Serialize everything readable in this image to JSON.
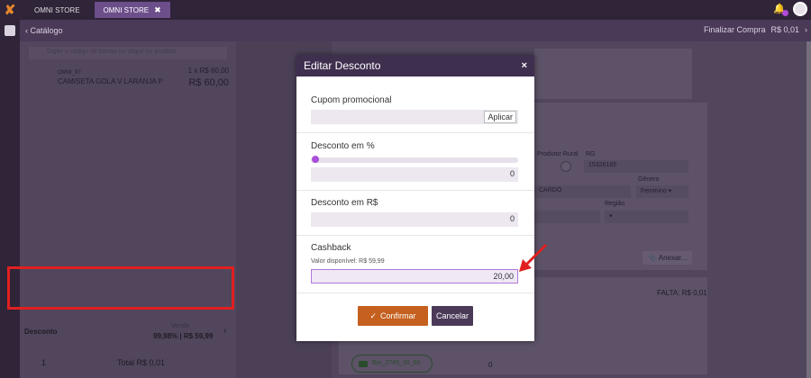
{
  "topbar": {
    "tabs": [
      {
        "label": "OMNI STORE",
        "active": false
      },
      {
        "label": "OMNI STORE",
        "active": true
      }
    ],
    "close_glyph": "✖"
  },
  "subbar": {
    "back_label": "Catálogo",
    "finalize_label": "Finalizar Compra",
    "finalize_value": "R$ 0,01"
  },
  "cart": {
    "search_placeholder": "Digite o código de barras ou clique no produto",
    "item": {
      "code": "OMNI_97",
      "name": "CAMISETA GOLA V LARANJA P",
      "qty": "1 x R$ 60,00",
      "price": "R$ 60,00"
    },
    "discount": {
      "label": "Desconto",
      "venda_label": "Venda",
      "value": "99,98% | R$ 59,99"
    },
    "footer": {
      "quantity": "1",
      "total": "Total R$ 0,01"
    }
  },
  "customer": {
    "produtor_label": "Produtor Rural",
    "rg_label": "RG",
    "rg_value": "15326165",
    "genero_label": "Gênero",
    "genero_value": "Feminino",
    "name_value": "CARDO",
    "regiao_label": "Região",
    "anexar_label": "Anexar..."
  },
  "payment": {
    "falta": "FALTA: R$ 0,01",
    "item_label": "Bm_2745_30_60",
    "item_value": "0"
  },
  "modal": {
    "title": "Editar Desconto",
    "close": "×",
    "coupon": {
      "label": "Cupom promocional",
      "value": "",
      "apply_label": "Aplicar"
    },
    "percent": {
      "label": "Desconto em %",
      "value": "0",
      "slider_fraction": 0
    },
    "reais": {
      "label": "Desconto em R$",
      "value": "0"
    },
    "cashback": {
      "label": "Cashback",
      "available": "Valor disponível: R$ 59,99",
      "value": "20,00"
    },
    "confirm_label": "Confirmar",
    "cancel_label": "Cancelar"
  },
  "colors": {
    "accent": "#a94fdc",
    "confirm": "#c5601f",
    "header": "#3f2f4f",
    "highlight": "#e02020"
  }
}
